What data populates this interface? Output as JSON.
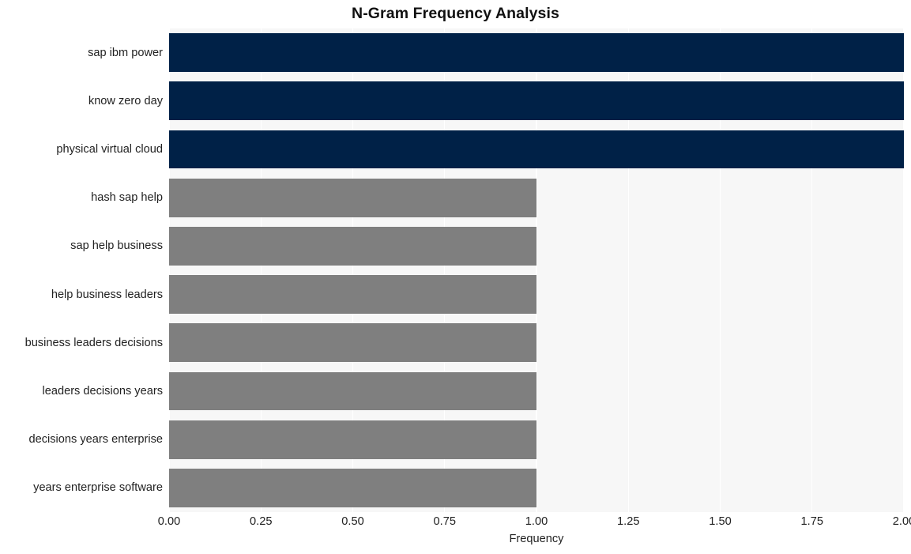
{
  "chart_data": {
    "type": "bar",
    "orientation": "horizontal",
    "title": "N-Gram Frequency Analysis",
    "xlabel": "Frequency",
    "ylabel": "",
    "categories": [
      "sap ibm power",
      "know zero day",
      "physical virtual cloud",
      "hash sap help",
      "sap help business",
      "help business leaders",
      "business leaders decisions",
      "leaders decisions years",
      "decisions years enterprise",
      "years enterprise software"
    ],
    "values": [
      2,
      2,
      2,
      1,
      1,
      1,
      1,
      1,
      1,
      1
    ],
    "bar_colors": [
      "#002147",
      "#002147",
      "#002147",
      "#7f7f7f",
      "#7f7f7f",
      "#7f7f7f",
      "#7f7f7f",
      "#7f7f7f",
      "#7f7f7f",
      "#7f7f7f"
    ],
    "xlim": [
      0.0,
      2.0
    ],
    "xticks": [
      0.0,
      0.25,
      0.5,
      0.75,
      1.0,
      1.25,
      1.5,
      1.75,
      2.0
    ],
    "xtick_labels": [
      "0.00",
      "0.25",
      "0.50",
      "0.75",
      "1.00",
      "1.25",
      "1.50",
      "1.75",
      "2.00"
    ],
    "grid": true,
    "grid_axis": "x",
    "grid_color": "#ffffff",
    "plot_background": "#f7f7f7",
    "figure_background": "#ffffff",
    "legend": null
  }
}
